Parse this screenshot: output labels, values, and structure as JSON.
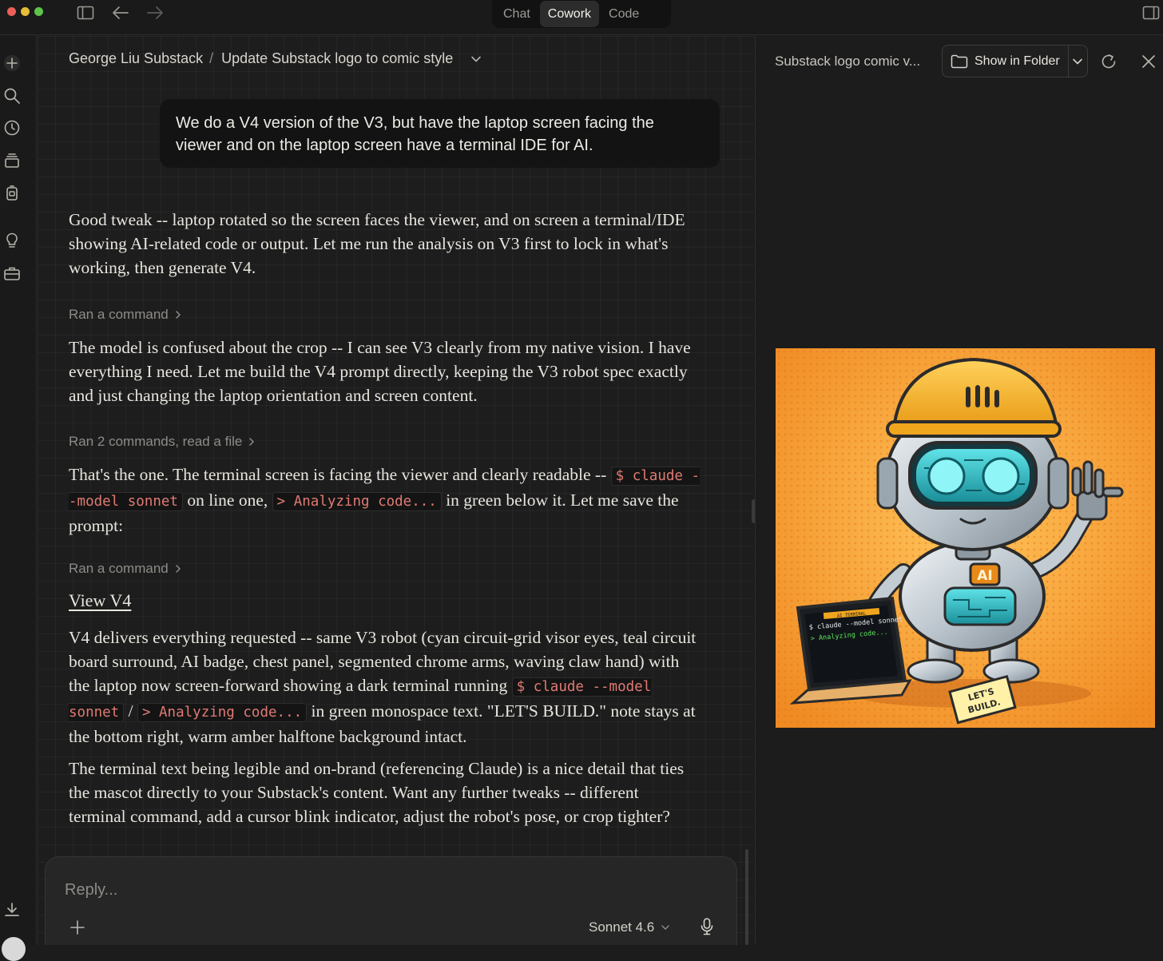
{
  "titlebar": {
    "modes": [
      {
        "label": "Chat",
        "active": false
      },
      {
        "label": "Cowork",
        "active": true
      },
      {
        "label": "Code",
        "active": false
      }
    ],
    "icons": [
      "sidebar-toggle-icon",
      "back-arrow-icon",
      "forward-arrow-icon",
      "panel-toggle-icon"
    ]
  },
  "rail": {
    "icons": [
      "plus-icon",
      "search-icon",
      "clock-icon",
      "stack-icon",
      "device-icon",
      "lightbulb-icon",
      "toolbox-icon",
      "download-icon"
    ]
  },
  "breadcrumb": {
    "project": "George Liu Substack",
    "separator": "/",
    "conversation": "Update Substack logo to comic style"
  },
  "messages": {
    "user": "We do a V4 version of the V3, but have the laptop screen facing the viewer and on the laptop screen have a terminal IDE for AI.",
    "p1": "Good tweak -- laptop rotated so the screen faces the viewer, and on screen a terminal/IDE showing AI-related code or output. Let me run the analysis on V3 first to lock in what's working, then generate V4.",
    "ran1": "Ran a command",
    "p2": "The model is confused about the crop -- I can see V3 clearly from my native vision. I have everything I need. Let me build the V4 prompt directly, keeping the V3 robot spec exactly and just changing the laptop orientation and screen content.",
    "ran2": "Ran 2 commands, read a file",
    "p3_a": "That's the one. The terminal screen is facing the viewer and clearly readable -- ",
    "p3_code1": "$ claude --model sonnet",
    "p3_b": " on line one, ",
    "p3_code2": "> Analyzing code...",
    "p3_c": " in green below it. Let me save the prompt:",
    "ran3": "Ran a command",
    "view_link": "View V4",
    "p4_a": "V4 delivers everything requested -- same V3 robot (cyan circuit-grid visor eyes, teal circuit board surround, AI badge, chest panel, segmented chrome arms, waving claw hand) with the laptop now screen-forward showing a dark terminal running ",
    "p4_code1": "$ claude --model sonnet",
    "p4_b": " / ",
    "p4_code2": "> Analyzing code...",
    "p4_c": " in green monospace text. \"LET'S BUILD.\" note stays at the bottom right, warm amber halftone background intact.",
    "p5": "The terminal text being legible and on-brand (referencing Claude) is a nice detail that ties the mascot directly to your Substack's content. Want any further tweaks -- different terminal command, add a cursor blink indicator, adjust the robot's pose, or crop tighter?"
  },
  "composer": {
    "placeholder": "Reply...",
    "model": "Sonnet 4.6"
  },
  "preview": {
    "title": "Substack logo comic v...",
    "show_in_folder": "Show in Folder",
    "image": {
      "badge": "AI",
      "terminal_header": "AI TERMINAL",
      "terminal_line1": "$ claude --model sonnet",
      "terminal_line2": "> Analyzing code...",
      "note_line1": "LET'S",
      "note_line2": "BUILD."
    }
  },
  "colors": {
    "background": "#1d1d1d",
    "code_text": "#e07a73",
    "active_tab": "#2c2c2c",
    "art_orange": "#f39b2f"
  }
}
